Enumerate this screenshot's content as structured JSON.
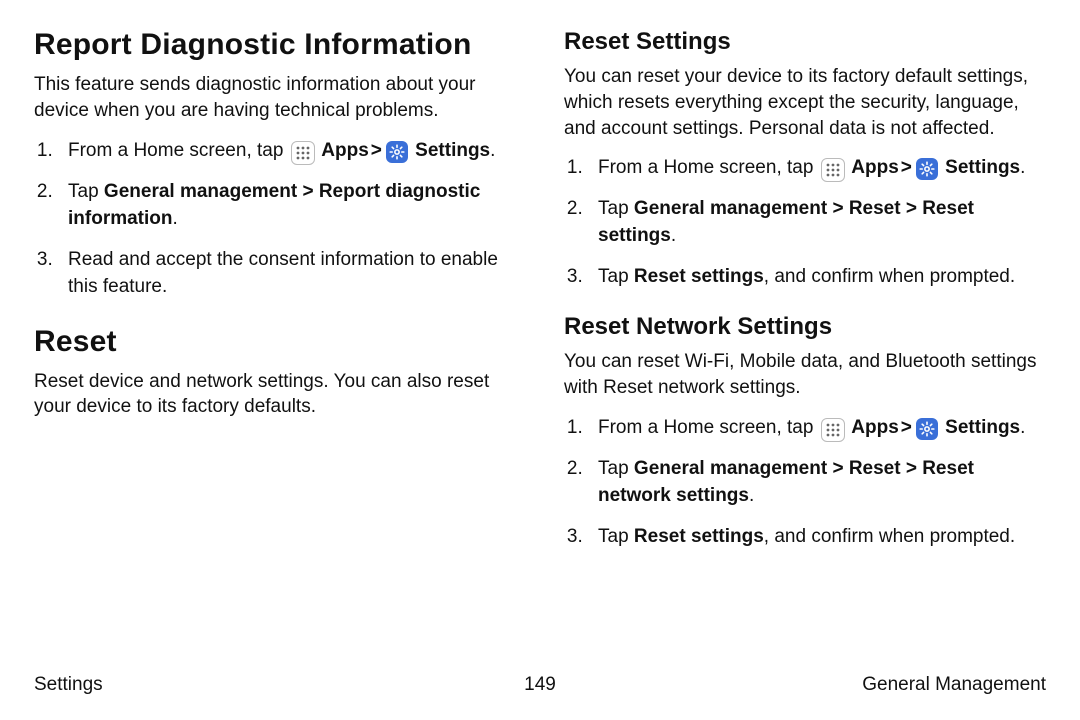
{
  "left": {
    "h1a": "Report Diagnostic Information",
    "lead_a": "This feature sends diagnostic information about your device when you are having technical problems.",
    "ol_a": [
      {
        "segments": [
          {
            "t": "From a Home screen, tap "
          },
          {
            "icon": "apps"
          },
          {
            "t": " Apps",
            "b": true
          },
          {
            "t": " ",
            "chev": true
          },
          {
            "icon": "settings"
          },
          {
            "t": " Settings",
            "b": true
          },
          {
            "t": "."
          }
        ]
      },
      {
        "segments": [
          {
            "t": "Tap "
          },
          {
            "t": "General management > Report diagnostic information",
            "b": true
          },
          {
            "t": "."
          }
        ]
      },
      {
        "segments": [
          {
            "t": "Read and accept the consent information to enable this feature."
          }
        ]
      }
    ],
    "h1b": "Reset",
    "lead_b": "Reset device and network settings. You can also reset your device to its factory defaults."
  },
  "right": {
    "h2a": "Reset Settings",
    "lead_a": "You can reset your device to its factory default settings, which resets everything except the security, language, and account settings. Personal data is not affected.",
    "ol_a": [
      {
        "segments": [
          {
            "t": "From a Home screen, tap "
          },
          {
            "icon": "apps"
          },
          {
            "t": " Apps",
            "b": true
          },
          {
            "t": " ",
            "chev": true
          },
          {
            "icon": "settings"
          },
          {
            "t": " Settings",
            "b": true
          },
          {
            "t": "."
          }
        ]
      },
      {
        "segments": [
          {
            "t": "Tap "
          },
          {
            "t": "General management > Reset > Reset settings",
            "b": true
          },
          {
            "t": "."
          }
        ]
      },
      {
        "segments": [
          {
            "t": "Tap "
          },
          {
            "t": "Reset settings",
            "b": true
          },
          {
            "t": ", and confirm when prompted."
          }
        ]
      }
    ],
    "h2b": "Reset Network Settings",
    "lead_b": "You can reset Wi-Fi, Mobile data, and Bluetooth settings with Reset network settings.",
    "ol_b": [
      {
        "segments": [
          {
            "t": "From a Home screen, tap "
          },
          {
            "icon": "apps"
          },
          {
            "t": " Apps",
            "b": true
          },
          {
            "t": " ",
            "chev": true
          },
          {
            "icon": "settings"
          },
          {
            "t": " Settings",
            "b": true
          },
          {
            "t": "."
          }
        ]
      },
      {
        "segments": [
          {
            "t": "Tap "
          },
          {
            "t": "General management > Reset > Reset network settings",
            "b": true
          },
          {
            "t": "."
          }
        ]
      },
      {
        "segments": [
          {
            "t": "Tap "
          },
          {
            "t": "Reset settings",
            "b": true
          },
          {
            "t": ", and confirm when prompted."
          }
        ]
      }
    ]
  },
  "footer": {
    "left": "Settings",
    "center": "149",
    "right": "General Management"
  }
}
